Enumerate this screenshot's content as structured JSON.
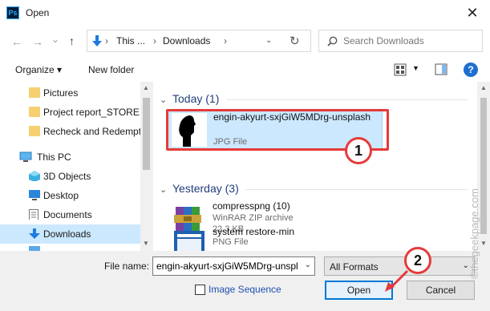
{
  "window": {
    "app_icon": "Ps",
    "title": "Open",
    "close": "✕"
  },
  "nav": {
    "back": "←",
    "forward": "→",
    "dropdown": "⌄",
    "up": "↑",
    "breadcrumb": [
      "This ...",
      "Downloads"
    ],
    "refresh": "↻",
    "search_placeholder": "Search Downloads"
  },
  "toolbar": {
    "organize": "Organize ▾",
    "new_folder": "New folder",
    "help": "?"
  },
  "sidebar": {
    "items": [
      {
        "label": "Pictures",
        "icon": "folder-icon"
      },
      {
        "label": "Project report_STORE",
        "icon": "folder-icon"
      },
      {
        "label": "Recheck and Redempt",
        "icon": "folder-icon"
      },
      {
        "label": "This PC",
        "icon": "computer-icon"
      },
      {
        "label": "3D Objects",
        "icon": "3d-objects-icon"
      },
      {
        "label": "Desktop",
        "icon": "desktop-icon"
      },
      {
        "label": "Documents",
        "icon": "documents-icon"
      },
      {
        "label": "Downloads",
        "icon": "downloads-icon"
      }
    ]
  },
  "groups": [
    {
      "header": "Today (1)",
      "files": [
        {
          "name": "engin-akyurt-sxjGiW5MDrg-unsplash",
          "type": "JPG File",
          "size": ""
        }
      ]
    },
    {
      "header": "Yesterday (3)",
      "files": [
        {
          "name": "compresspng (10)",
          "type": "WinRAR ZIP archive",
          "size": "22.3 KB"
        },
        {
          "name": "system restore-min",
          "type": "PNG File",
          "size": ""
        }
      ]
    }
  ],
  "footer": {
    "file_name_label": "File name:",
    "file_name_value": "engin-akyurt-sxjGiW5MDrg-unspl",
    "format": "All Formats",
    "image_sequence": "Image Sequence",
    "open": "Open",
    "cancel": "Cancel"
  },
  "annotations": {
    "step1": "1",
    "step2": "2"
  },
  "watermark": "©thegeekpage.com",
  "colors": {
    "selection": "#cce8ff",
    "accent": "#0078d7",
    "annotation_red": "#e53a3a",
    "group_header": "#1f3d7a"
  }
}
